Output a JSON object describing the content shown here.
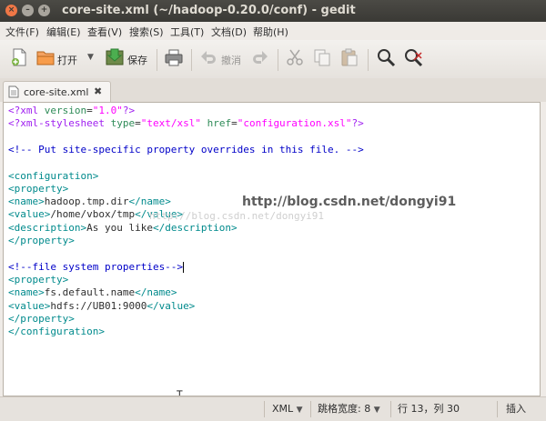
{
  "window": {
    "title": "core-site.xml (~/hadoop-0.20.0/conf) - gedit",
    "controls": {
      "close": "×",
      "minimize": "–",
      "maximize": "+"
    }
  },
  "menubar": {
    "items": [
      {
        "label": "文件(F)"
      },
      {
        "label": "编辑(E)"
      },
      {
        "label": "查看(V)"
      },
      {
        "label": "搜索(S)"
      },
      {
        "label": "工具(T)"
      },
      {
        "label": "文档(D)"
      },
      {
        "label": "帮助(H)"
      }
    ]
  },
  "toolbar": {
    "open_label": "打开",
    "save_label": "保存",
    "undo_label": "撤消",
    "icons": [
      "new-document-icon",
      "open-folder-icon",
      "dropdown-arrow-icon",
      "save-icon",
      "print-icon",
      "undo-icon",
      "redo-icon",
      "cut-icon",
      "copy-icon",
      "paste-icon",
      "find-icon",
      "find-replace-icon"
    ]
  },
  "tab": {
    "label": "core-site.xml",
    "close": "✖"
  },
  "editor": {
    "lines": [
      [
        {
          "c": "kw",
          "t": "<?xml"
        },
        {
          "c": "attr",
          "t": " version"
        },
        {
          "c": "txt",
          "t": "="
        },
        {
          "c": "str",
          "t": "\"1.0\""
        },
        {
          "c": "kw",
          "t": "?>"
        }
      ],
      [
        {
          "c": "kw",
          "t": "<?xml-stylesheet"
        },
        {
          "c": "attr",
          "t": " type"
        },
        {
          "c": "txt",
          "t": "="
        },
        {
          "c": "str",
          "t": "\"text/xsl\""
        },
        {
          "c": "attr",
          "t": " href"
        },
        {
          "c": "txt",
          "t": "="
        },
        {
          "c": "str",
          "t": "\"configuration.xsl\""
        },
        {
          "c": "kw",
          "t": "?>"
        }
      ],
      [],
      [
        {
          "c": "cmt",
          "t": "<!-- Put site-specific property overrides in this file. -->"
        }
      ],
      [],
      [
        {
          "c": "tag",
          "t": "<configuration>"
        }
      ],
      [
        {
          "c": "tag",
          "t": "<property>"
        }
      ],
      [
        {
          "c": "tag",
          "t": "<name>"
        },
        {
          "c": "txt",
          "t": "hadoop.tmp.dir"
        },
        {
          "c": "tag",
          "t": "</name>"
        }
      ],
      [
        {
          "c": "tag",
          "t": "<value>"
        },
        {
          "c": "txt",
          "t": "/home/vbox/tmp"
        },
        {
          "c": "tag",
          "t": "</value>"
        }
      ],
      [
        {
          "c": "tag",
          "t": "<description>"
        },
        {
          "c": "txt",
          "t": "As you like"
        },
        {
          "c": "tag",
          "t": "</description>"
        }
      ],
      [
        {
          "c": "tag",
          "t": "</property>"
        }
      ],
      [],
      [
        {
          "c": "cmt",
          "t": "<!--file system properties-->"
        }
      ],
      [
        {
          "c": "tag",
          "t": "<property>"
        }
      ],
      [
        {
          "c": "tag",
          "t": "<name>"
        },
        {
          "c": "txt",
          "t": "fs.default.name"
        },
        {
          "c": "tag",
          "t": "</name>"
        }
      ],
      [
        {
          "c": "tag",
          "t": "<value>"
        },
        {
          "c": "txt",
          "t": "hdfs://UB01:9000"
        },
        {
          "c": "tag",
          "t": "</value>"
        }
      ],
      [
        {
          "c": "tag",
          "t": "</property>"
        }
      ],
      [
        {
          "c": "tag",
          "t": "</configuration>"
        }
      ]
    ],
    "caret_line": 12,
    "watermark_bold": "http://blog.csdn.net/dongyi91",
    "watermark_faint": "http://blog.csdn.net/dongyi91"
  },
  "statusbar": {
    "language": "XML",
    "tab_width": "跳格宽度: 8",
    "position": "行 13，列 30",
    "mode": "插入",
    "arrow": "▼"
  },
  "colors": {
    "keyword": "#a020f0",
    "string": "#ff00ff",
    "attribute": "#2e8b57",
    "comment": "#0000c8",
    "tag": "#008a8c",
    "titlebar": "#3c3b37",
    "close_button": "#f07746"
  }
}
